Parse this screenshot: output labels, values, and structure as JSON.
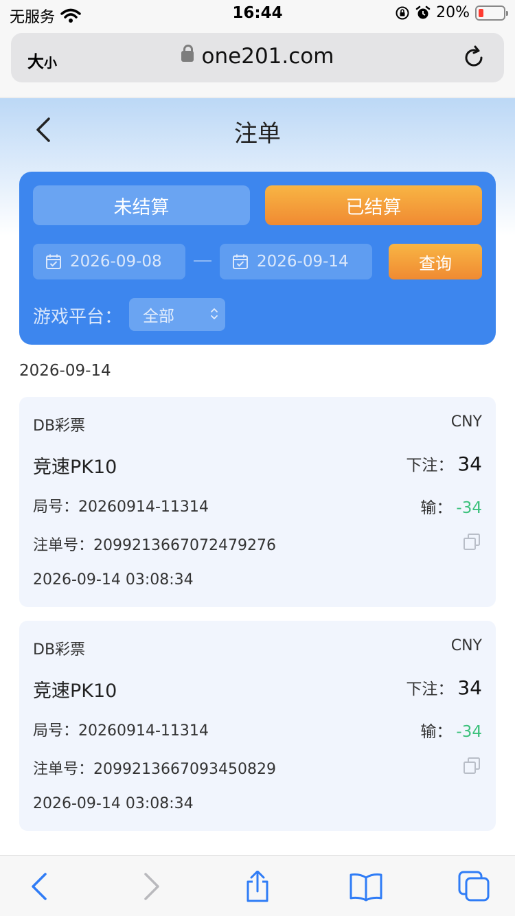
{
  "status_bar": {
    "carrier": "无服务",
    "time": "16:44",
    "battery": "20%",
    "battery_level": 0.2
  },
  "browser": {
    "size_label_big": "大",
    "size_label_small": "小",
    "url": "one201.com"
  },
  "header": {
    "title": "注单"
  },
  "filters": {
    "tab_unsettled": "未结算",
    "tab_settled": "已结算",
    "active_tab": "已结算",
    "date_start": "2026-09-08",
    "date_end": "2026-09-14",
    "query_label": "查询",
    "platform_label": "游戏平台：",
    "platform_value": "全部"
  },
  "group": {
    "date": "2026-09-14"
  },
  "bets": [
    {
      "provider": "DB彩票",
      "currency": "CNY",
      "game": "竞速PK10",
      "stake_label": "下注：",
      "stake": "34",
      "round_label": "局号：",
      "round": "20260914-11314",
      "result_label": "输：",
      "result": "-34",
      "order_label": "注单号：",
      "order": "2099213667072479276",
      "time": "2026-09-14 03:08:34"
    },
    {
      "provider": "DB彩票",
      "currency": "CNY",
      "game": "竞速PK10",
      "stake_label": "下注：",
      "stake": "34",
      "round_label": "局号：",
      "round": "20260914-11314",
      "result_label": "输：",
      "result": "-34",
      "order_label": "注单号：",
      "order": "2099213667093450829",
      "time": "2026-09-14 03:08:34"
    }
  ],
  "colors": {
    "primary_blue": "#3d86ee",
    "orange": "#f08a32",
    "loss_green": "#3cc17c"
  }
}
